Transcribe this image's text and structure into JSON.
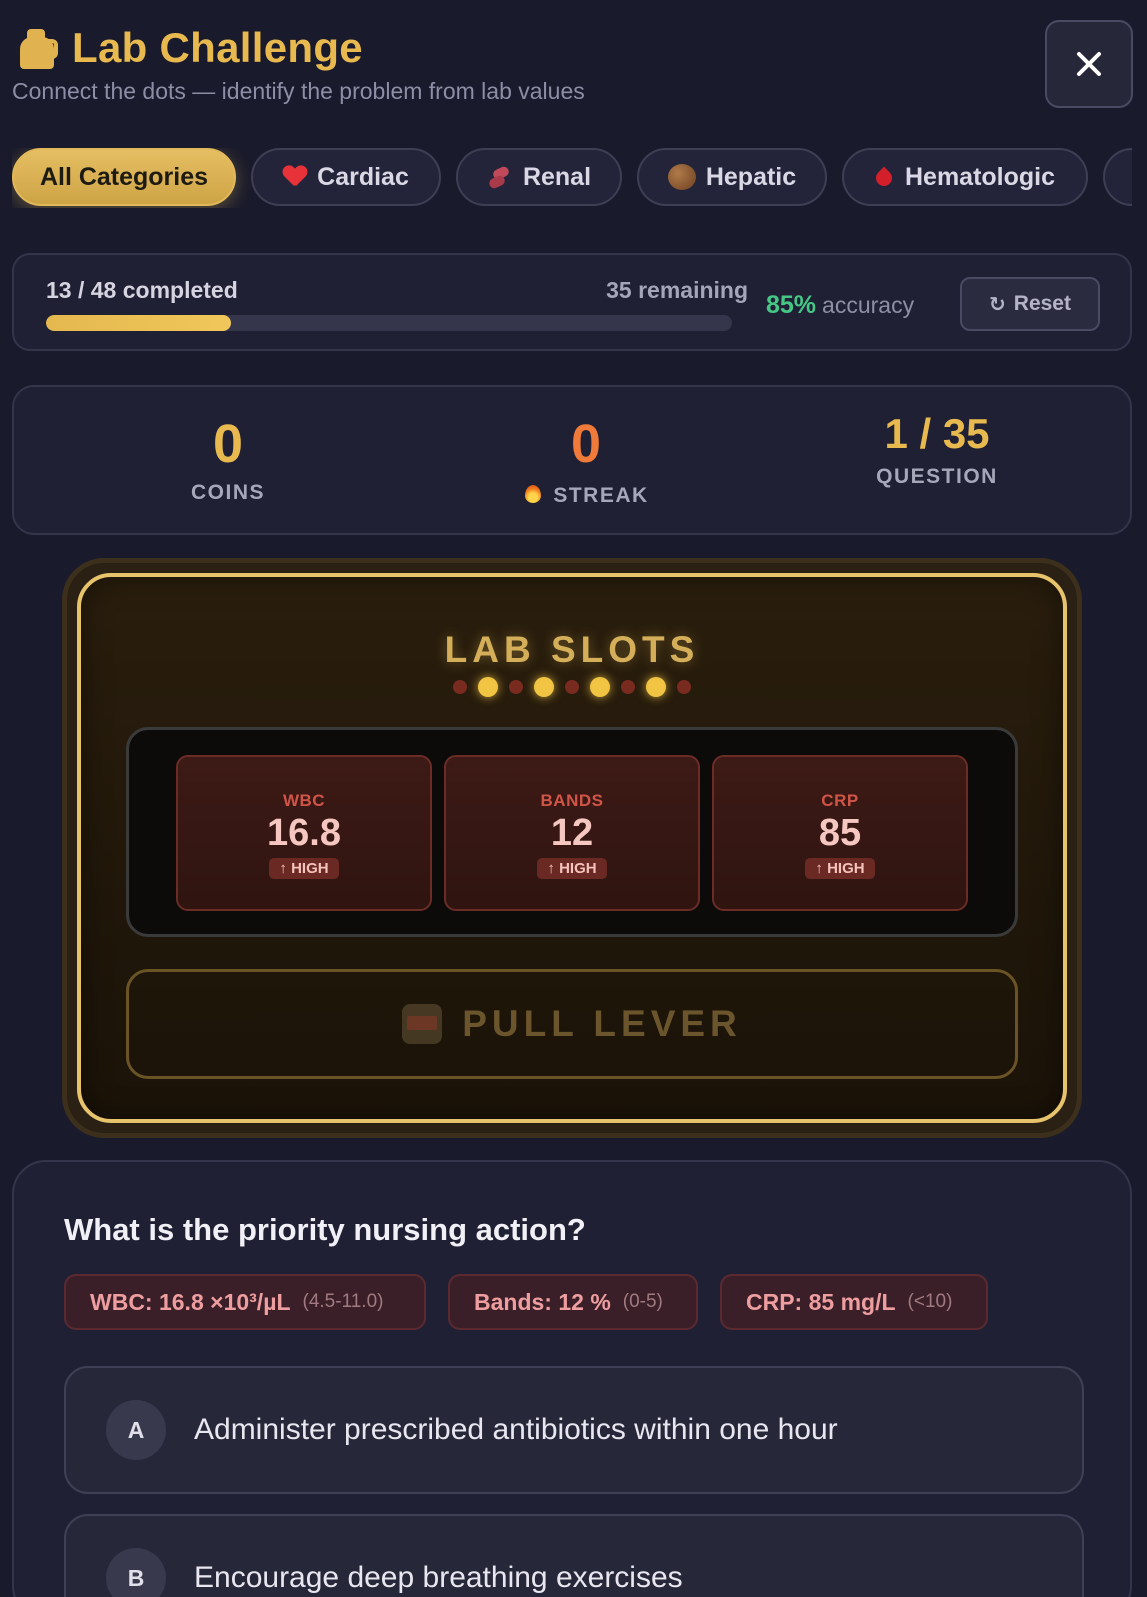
{
  "header": {
    "title": "Lab Challenge",
    "subtitle": "Connect the dots — identify the problem from lab values",
    "close_label": "×"
  },
  "tabs": [
    {
      "label": "All Categories",
      "icon": "",
      "active": true
    },
    {
      "label": "Cardiac",
      "icon": "heart-icon",
      "active": false
    },
    {
      "label": "Renal",
      "icon": "kidney-icon",
      "active": false
    },
    {
      "label": "Hepatic",
      "icon": "liver-icon",
      "active": false
    },
    {
      "label": "Hematologic",
      "icon": "blood-drop-icon",
      "active": false
    }
  ],
  "progress": {
    "completed_text": "13 / 48 completed",
    "remaining_text": "35 remaining",
    "fraction": 0.27,
    "accuracy_value": "85%",
    "accuracy_label": "accuracy",
    "reset_label": "Reset"
  },
  "stats": {
    "coins": "0",
    "coins_label": "COINS",
    "streak": "0",
    "streak_label": "STREAK",
    "question": "1 / 35",
    "question_label": "QUESTION"
  },
  "slots": {
    "title": "LAB SLOTS",
    "lights": [
      false,
      true,
      false,
      true,
      false,
      true,
      false,
      true,
      false
    ],
    "reels": [
      {
        "label": "WBC",
        "value": "16.8",
        "badge": "↑ HIGH"
      },
      {
        "label": "BANDS",
        "value": "12",
        "badge": "↑ HIGH"
      },
      {
        "label": "CRP",
        "value": "85",
        "badge": "↑ HIGH"
      }
    ],
    "lever_label": "PULL LEVER"
  },
  "question": {
    "title": "What is the priority nursing action?",
    "chips": [
      {
        "value": "WBC: 16.8 ×10³/µL",
        "range": "(4.5-11.0)"
      },
      {
        "value": "Bands: 12 %",
        "range": "(0-5)"
      },
      {
        "value": "CRP: 85 mg/L",
        "range": "(<10)"
      }
    ],
    "options": [
      {
        "letter": "A",
        "text": "Administer prescribed antibiotics within one hour"
      },
      {
        "letter": "B",
        "text": "Encourage deep breathing exercises"
      }
    ]
  },
  "colors": {
    "accent_gold": "#e8b94f",
    "streak_orange": "#ef7a3a",
    "accuracy_green": "#46c785",
    "high_red": "#d05548"
  }
}
